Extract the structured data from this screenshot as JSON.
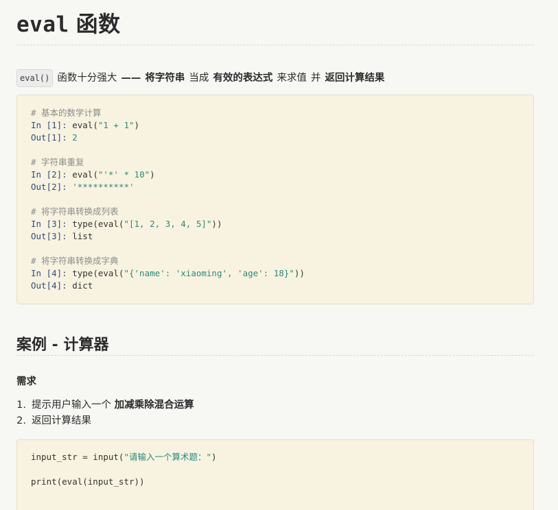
{
  "heading": {
    "code": "eval",
    "text": "函数"
  },
  "intro": {
    "code": "eval()",
    "p1": "函数十分强大",
    "dash": "——",
    "b1": "将字符串",
    "p2": "当成",
    "b2": "有效的表达式",
    "p3": "来求值",
    "p4": "并",
    "b3": "返回计算结果"
  },
  "code_block_1": {
    "lines": [
      [
        {
          "t": "# 基本的数学计算",
          "c": "cm"
        }
      ],
      [
        {
          "t": "In [1]: ",
          "c": "kw"
        },
        {
          "t": "eval(",
          "c": ""
        },
        {
          "t": "\"1 + 1\"",
          "c": "str"
        },
        {
          "t": ")",
          "c": ""
        }
      ],
      [
        {
          "t": "Out[1]: ",
          "c": "kw"
        },
        {
          "t": "2",
          "c": "num"
        }
      ],
      [],
      [
        {
          "t": "# 字符串重复",
          "c": "cm"
        }
      ],
      [
        {
          "t": "In [2]: ",
          "c": "kw"
        },
        {
          "t": "eval(",
          "c": ""
        },
        {
          "t": "\"'*' * 10\"",
          "c": "str"
        },
        {
          "t": ")",
          "c": ""
        }
      ],
      [
        {
          "t": "Out[2]: ",
          "c": "kw"
        },
        {
          "t": "'**********'",
          "c": "str"
        }
      ],
      [],
      [
        {
          "t": "# 将字符串转换成列表",
          "c": "cm"
        }
      ],
      [
        {
          "t": "In [3]: ",
          "c": "kw"
        },
        {
          "t": "type(eval(",
          "c": ""
        },
        {
          "t": "\"[1, 2, 3, 4, 5]\"",
          "c": "str"
        },
        {
          "t": "))",
          "c": ""
        }
      ],
      [
        {
          "t": "Out[3]: ",
          "c": "kw"
        },
        {
          "t": "list",
          "c": ""
        }
      ],
      [],
      [
        {
          "t": "# 将字符串转换成字典",
          "c": "cm"
        }
      ],
      [
        {
          "t": "In [4]: ",
          "c": "kw"
        },
        {
          "t": "type(eval(",
          "c": ""
        },
        {
          "t": "\"{'name': 'xiaoming', 'age': 18}\"",
          "c": "str"
        },
        {
          "t": "))",
          "c": ""
        }
      ],
      [
        {
          "t": "Out[4]: ",
          "c": "kw"
        },
        {
          "t": "dict",
          "c": ""
        }
      ]
    ]
  },
  "section": {
    "title": "案例 - 计算器",
    "subhead": "需求",
    "items": [
      {
        "num": "1.",
        "plain": "提示用户输入一个",
        "bold": "加减乘除混合运算"
      },
      {
        "num": "2.",
        "plain": "返回计算结果",
        "bold": ""
      }
    ]
  },
  "code_block_2": {
    "lines": [
      [
        {
          "t": "input_str = input(",
          "c": ""
        },
        {
          "t": "\"请输入一个算术题：\"",
          "c": "str"
        },
        {
          "t": ")",
          "c": ""
        }
      ],
      [],
      [
        {
          "t": "print(eval(input_str))",
          "c": ""
        }
      ]
    ]
  },
  "colors": {
    "code_bg": "#f8f3e0",
    "string": "#2a8a7a",
    "comment": "#8b8b8b"
  }
}
